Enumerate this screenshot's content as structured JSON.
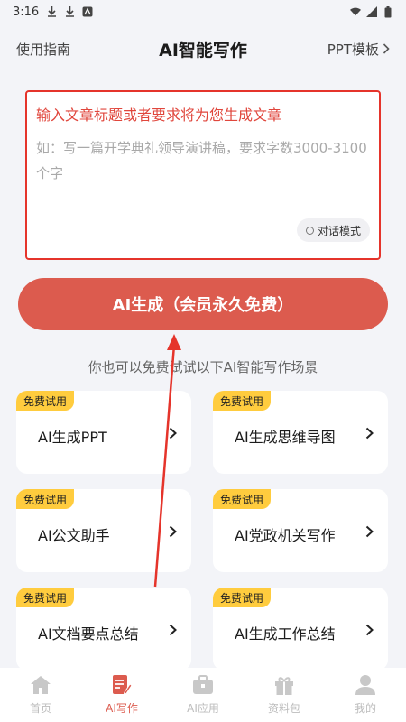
{
  "status_bar": {
    "time": "3:16"
  },
  "header": {
    "left_label": "使用指南",
    "title": "AI智能写作",
    "right_label": "PPT模板"
  },
  "input": {
    "title": "输入文章标题或者要求将为您生成文章",
    "placeholder": "如：写一篇开学典礼领导演讲稿，要求字数3000-3100个字",
    "chat_mode_label": "对话模式"
  },
  "generate_button": {
    "label": "AI生成（会员永久免费）"
  },
  "hint": "你也可以免费试试以下AI智能写作场景",
  "scenes": [
    {
      "badge": "免费试用",
      "label": "AI生成PPT"
    },
    {
      "badge": "免费试用",
      "label": "AI生成思维导图"
    },
    {
      "badge": "免费试用",
      "label": "AI公文助手"
    },
    {
      "badge": "免费试用",
      "label": "AI党政机关写作"
    },
    {
      "badge": "免费试用",
      "label": "AI文档要点总结"
    },
    {
      "badge": "免费试用",
      "label": "AI生成工作总结"
    }
  ],
  "tabs": [
    {
      "label": "首页",
      "icon": "home-icon",
      "active": false
    },
    {
      "label": "AI写作",
      "icon": "write-icon",
      "active": true
    },
    {
      "label": "AI应用",
      "icon": "toolbox-icon",
      "active": false
    },
    {
      "label": "资料包",
      "icon": "gift-icon",
      "active": false
    },
    {
      "label": "我的",
      "icon": "profile-icon",
      "active": false
    }
  ],
  "colors": {
    "accent": "#dc5b4e",
    "badge": "#ffcc3e",
    "annotation": "#e5342b"
  }
}
